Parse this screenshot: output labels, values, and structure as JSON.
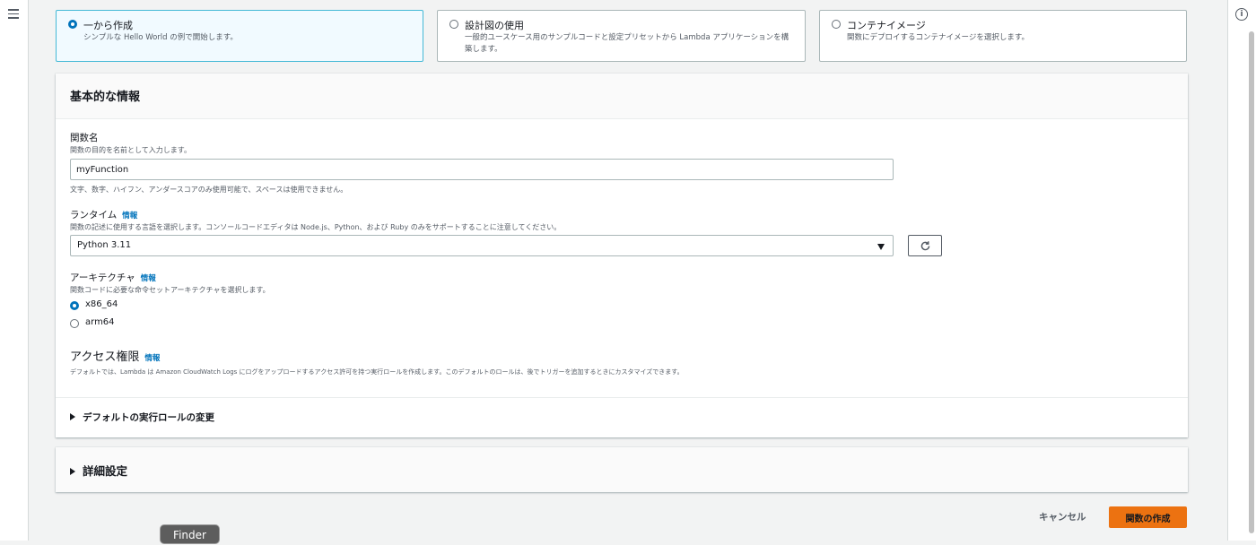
{
  "options": [
    {
      "title": "一から作成",
      "desc": "シンプルな Hello World の例で開始します。",
      "selected": true
    },
    {
      "title": "設計図の使用",
      "desc": "一般的ユースケース用のサンプルコードと設定プリセットから Lambda アプリケーションを構築します。",
      "selected": false
    },
    {
      "title": "コンテナイメージ",
      "desc": "関数にデプロイするコンテナイメージを選択します。",
      "selected": false
    }
  ],
  "basic_info": {
    "title": "基本的な情報",
    "function_name": {
      "label": "関数名",
      "desc": "関数の目的を名前として入力します。",
      "value": "myFunction",
      "hint": "文字、数字、ハイフン、アンダースコアのみ使用可能で、スペースは使用できません。"
    },
    "runtime": {
      "label": "ランタイム",
      "info": "情報",
      "desc": "関数の記述に使用する言語を選択します。コンソールコードエディタは Node.js、Python、および Ruby のみをサポートすることに注意してください。",
      "value": "Python 3.11"
    },
    "architecture": {
      "label": "アーキテクチャ",
      "info": "情報",
      "desc": "関数コードに必要な命令セットアーキテクチャを選択します。",
      "choices": [
        "x86_64",
        "arm64"
      ],
      "selected": "x86_64"
    },
    "permissions": {
      "label": "アクセス権限",
      "info": "情報",
      "desc": "デフォルトでは、Lambda は Amazon CloudWatch Logs にログをアップロードするアクセス許可を持つ実行ロールを作成します。このデフォルトのロールは、後でトリガーを追加するときにカスタマイズできます。"
    },
    "role_expander": "デフォルトの実行ロールの変更"
  },
  "advanced": {
    "title": "詳細設定"
  },
  "actions": {
    "cancel": "キャンセル",
    "create": "関数の作成"
  },
  "tooltip": "Finder",
  "colors": {
    "accent": "#0073bb",
    "primary_button": "#ec7211",
    "selected_tile": "#f1faff"
  }
}
